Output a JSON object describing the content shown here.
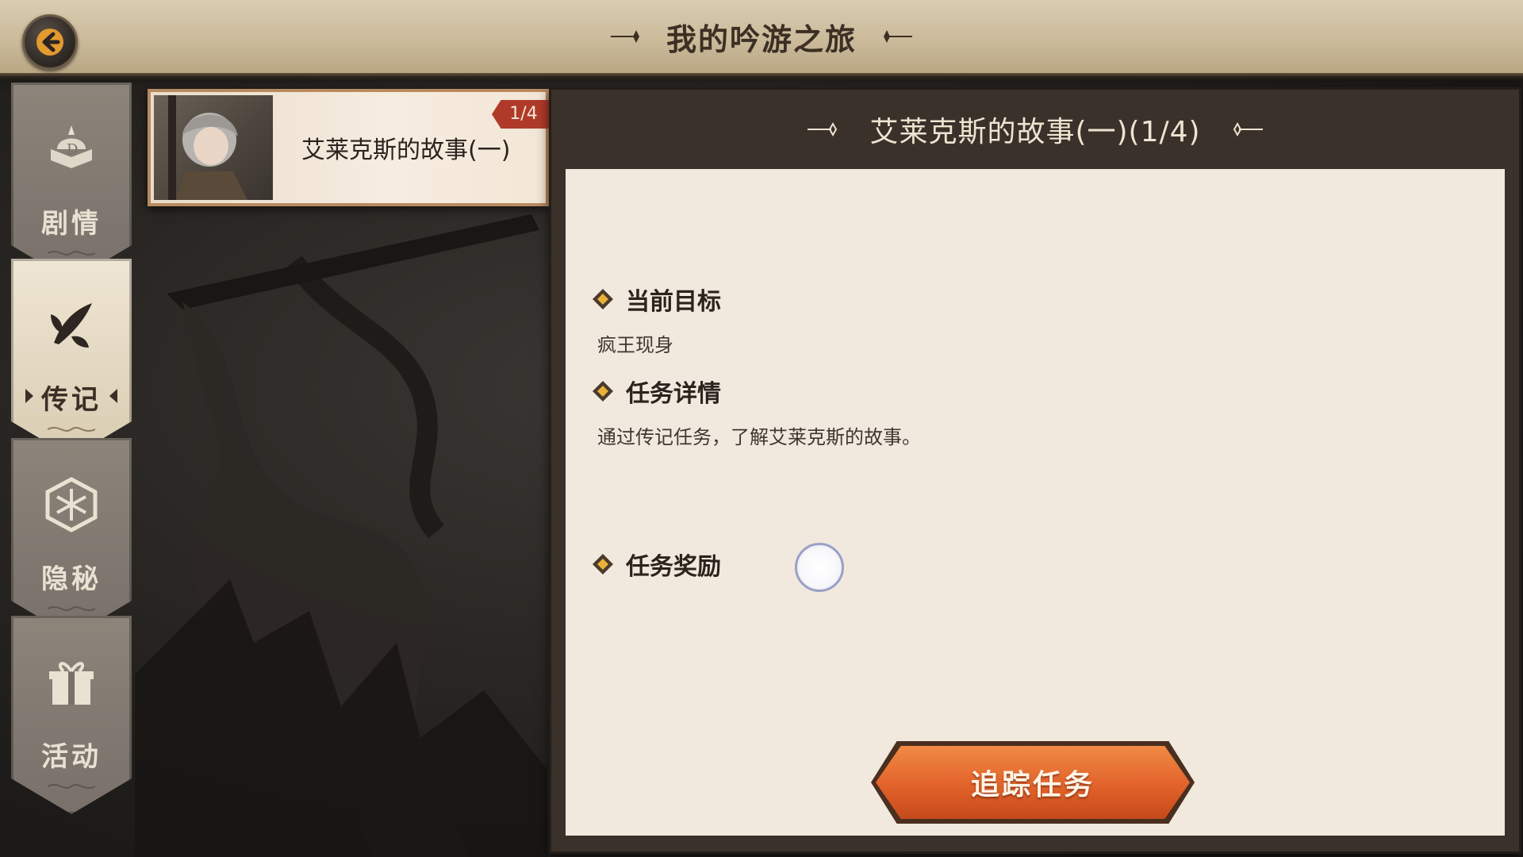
{
  "header": {
    "title": "我的吟游之旅"
  },
  "sidebar": {
    "tabs": [
      {
        "label": "剧情",
        "icon": "scroll-book-icon",
        "active": false
      },
      {
        "label": "传记",
        "icon": "quill-feather-icon",
        "active": true
      },
      {
        "label": "隐秘",
        "icon": "mystic-sigil-icon",
        "active": false
      },
      {
        "label": "活动",
        "icon": "gift-box-icon",
        "active": false
      }
    ]
  },
  "quest_list": {
    "items": [
      {
        "title": "艾莱克斯的故事(一)",
        "progress": "1/4",
        "portrait": "character-portrait"
      }
    ]
  },
  "detail": {
    "title": "艾莱克斯的故事(一)(1/4)",
    "current_goal_label": "当前目标",
    "current_goal_text": "疯王现身",
    "quest_detail_label": "任务详情",
    "quest_detail_text": "通过传记任务，了解艾莱克斯的故事。",
    "reward_label": "任务奖励",
    "track_button": "追踪任务"
  },
  "colors": {
    "accent_orange": "#e2622a",
    "badge_red": "#b03a2a",
    "parchment": "#f2e9de",
    "panel_dark": "#3a312b"
  }
}
